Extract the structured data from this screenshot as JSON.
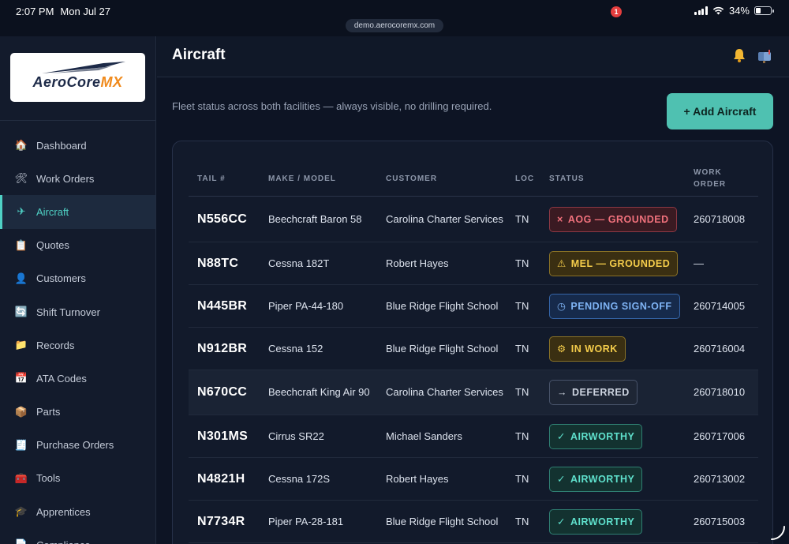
{
  "status_bar": {
    "time": "2:07 PM",
    "date": "Mon Jul 27",
    "battery": "34%",
    "battery_level": 0.34,
    "url": "demo.aerocoremx.com"
  },
  "brand": {
    "name_part1": "AeroCore",
    "name_part2": "MX",
    "accent": "#f08a1c"
  },
  "sidebar": {
    "items": [
      {
        "label": "Dashboard",
        "icon": "house-icon",
        "glyph": "🏠"
      },
      {
        "label": "Work Orders",
        "icon": "tools-icon",
        "glyph": "🛠"
      },
      {
        "label": "Aircraft",
        "icon": "airplane-icon",
        "glyph": "✈",
        "active": true
      },
      {
        "label": "Quotes",
        "icon": "clipboard-icon",
        "glyph": "📋"
      },
      {
        "label": "Customers",
        "icon": "person-icon",
        "glyph": "👤"
      },
      {
        "label": "Shift Turnover",
        "icon": "refresh-icon",
        "glyph": "🔄"
      },
      {
        "label": "Records",
        "icon": "folder-icon",
        "glyph": "📁"
      },
      {
        "label": "ATA Codes",
        "icon": "calendar-icon",
        "glyph": "📅"
      },
      {
        "label": "Parts",
        "icon": "package-icon",
        "glyph": "📦"
      },
      {
        "label": "Purchase Orders",
        "icon": "receipt-icon",
        "glyph": "🧾"
      },
      {
        "label": "Tools",
        "icon": "toolbox-icon",
        "glyph": "🧰"
      },
      {
        "label": "Apprentices",
        "icon": "graduation-cap-icon",
        "glyph": "🎓"
      },
      {
        "label": "Compliance",
        "icon": "document-icon",
        "glyph": "📄"
      }
    ]
  },
  "header": {
    "title": "Aircraft",
    "notification_count": "1"
  },
  "main": {
    "subtitle": "Fleet status across both facilities — always visible, no drilling required.",
    "add_button": "+ Add Aircraft"
  },
  "table": {
    "columns": {
      "tail": "TAIL #",
      "make": "MAKE / MODEL",
      "customer": "CUSTOMER",
      "loc": "LOC",
      "status": "STATUS",
      "wo_line1": "WORK",
      "wo_line2": "ORDER"
    },
    "rows": [
      {
        "tail": "N556CC",
        "make": "Beechcraft Baron 58",
        "customer": "Carolina Charter Services",
        "loc": "TN",
        "status": "AOG — GROUNDED",
        "status_icon": "×",
        "status_kind": "aog",
        "wo": "260718008"
      },
      {
        "tail": "N88TC",
        "make": "Cessna 182T",
        "customer": "Robert Hayes",
        "loc": "TN",
        "status": "MEL — GROUNDED",
        "status_icon": "⚠",
        "status_kind": "mel",
        "wo": "—"
      },
      {
        "tail": "N445BR",
        "make": "Piper PA-44-180",
        "customer": "Blue Ridge Flight School",
        "loc": "TN",
        "status": "PENDING SIGN-OFF",
        "status_icon": "◷",
        "status_kind": "pend",
        "wo": "260714005"
      },
      {
        "tail": "N912BR",
        "make": "Cessna 152",
        "customer": "Blue Ridge Flight School",
        "loc": "TN",
        "status": "IN WORK",
        "status_icon": "⚙",
        "status_kind": "work",
        "wo": "260716004"
      },
      {
        "tail": "N670CC",
        "make": "Beechcraft King Air 90",
        "customer": "Carolina Charter Services",
        "loc": "TN",
        "status": "DEFERRED",
        "status_icon": "→",
        "status_kind": "def",
        "wo": "260718010",
        "highlight": true
      },
      {
        "tail": "N301MS",
        "make": "Cirrus SR22",
        "customer": "Michael Sanders",
        "loc": "TN",
        "status": "AIRWORTHY",
        "status_icon": "✓",
        "status_kind": "air",
        "wo": "260717006"
      },
      {
        "tail": "N4821H",
        "make": "Cessna 172S",
        "customer": "Robert Hayes",
        "loc": "TN",
        "status": "AIRWORTHY",
        "status_icon": "✓",
        "status_kind": "air",
        "wo": "260713002"
      },
      {
        "tail": "N7734R",
        "make": "Piper PA-28-181",
        "customer": "Blue Ridge Flight School",
        "loc": "TN",
        "status": "AIRWORTHY",
        "status_icon": "✓",
        "status_kind": "air",
        "wo": "260715003"
      }
    ]
  }
}
